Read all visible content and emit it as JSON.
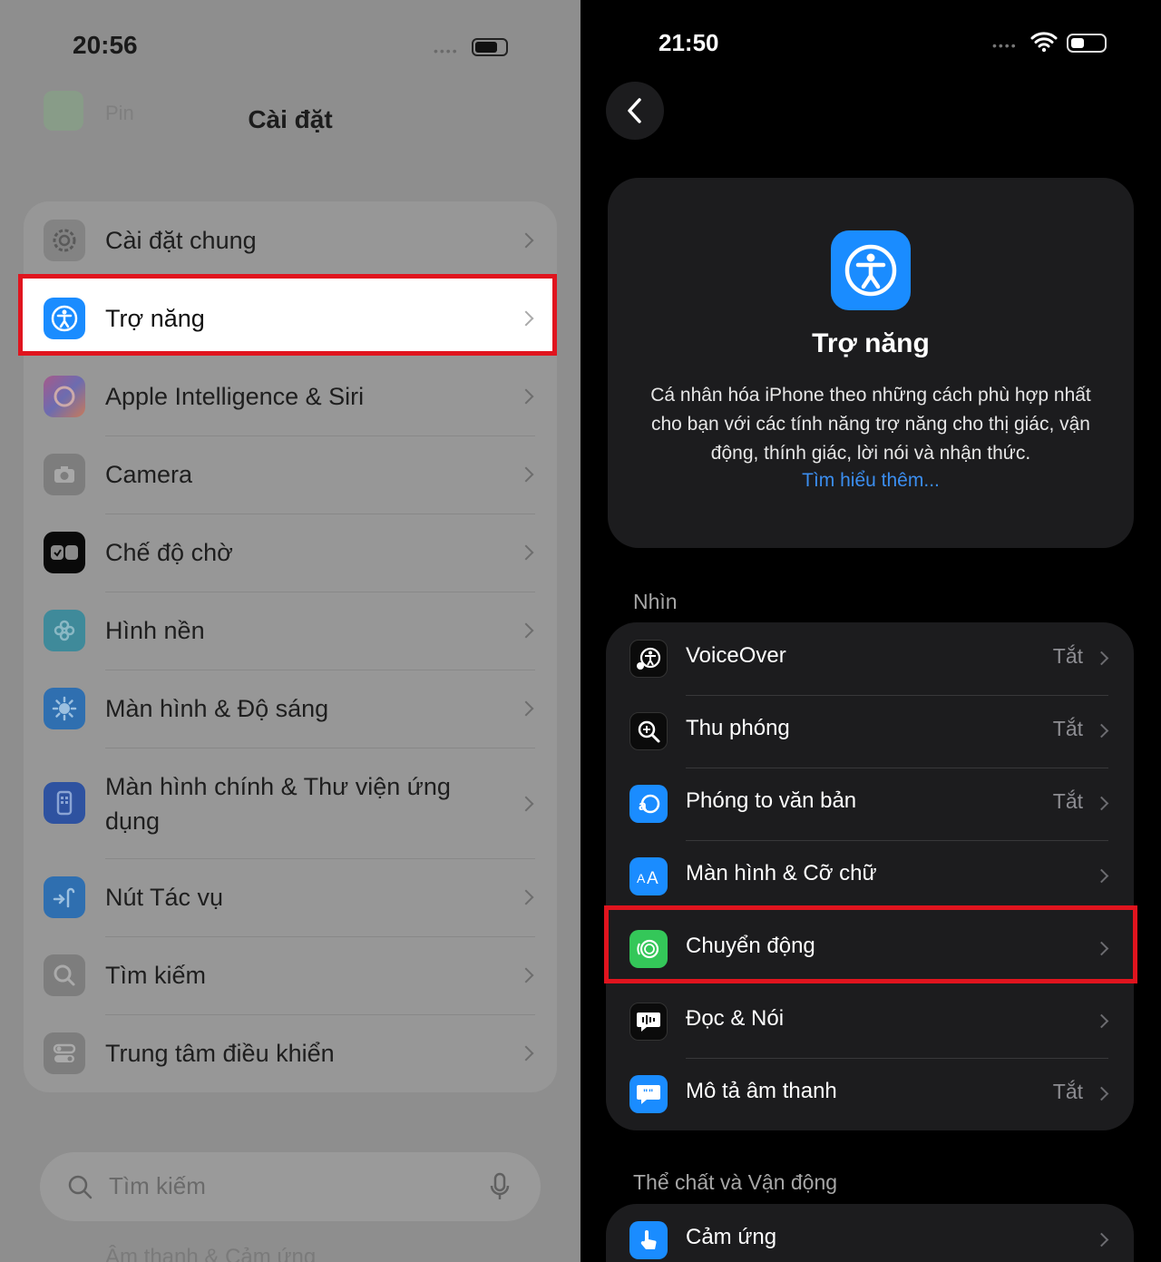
{
  "left": {
    "status_time": "20:56",
    "ghost_text": "Pin",
    "title": "Cài đặt",
    "items": [
      {
        "label": "Cài đặt chung",
        "icon": "gear-icon",
        "color": "#8e8e93"
      },
      {
        "label": "Trợ năng",
        "icon": "accessibility-icon",
        "color": "#1a8cff",
        "highlighted": true
      },
      {
        "label": "Apple Intelligence & Siri",
        "icon": "siri-icon",
        "color": "#b060c0"
      },
      {
        "label": "Camera",
        "icon": "camera-icon",
        "color": "#8e8e93"
      },
      {
        "label": "Chế độ chờ",
        "icon": "standby-icon",
        "color": "#000000"
      },
      {
        "label": "Hình nền",
        "icon": "wallpaper-icon",
        "color": "#34aadc"
      },
      {
        "label": "Màn hình & Độ sáng",
        "icon": "sun-icon",
        "color": "#1a8cff"
      },
      {
        "label": "Màn hình chính & Thư viện ứng dụng",
        "icon": "home-screen-icon",
        "color": "#2b62d8"
      },
      {
        "label": "Nút Tác vụ",
        "icon": "action-button-icon",
        "color": "#1a8cff"
      },
      {
        "label": "Tìm kiếm",
        "icon": "search-icon",
        "color": "#8e8e93"
      },
      {
        "label": "Trung tâm điều khiển",
        "icon": "control-center-icon",
        "color": "#8e8e93"
      }
    ],
    "search_placeholder": "Tìm kiếm",
    "ghost_bottom": "Âm thanh & Cảm ứng"
  },
  "right": {
    "status_time": "21:50",
    "hero": {
      "title": "Trợ năng",
      "description": "Cá nhân hóa iPhone theo những cách phù hợp nhất cho bạn với các tính năng trợ năng cho thị giác, vận động, thính giác, lời nói và nhận thức.",
      "link": "Tìm hiểu thêm..."
    },
    "section_vision": "Nhìn",
    "vision_items": [
      {
        "label": "VoiceOver",
        "value": "Tắt",
        "icon": "voiceover-icon",
        "color": "#000000"
      },
      {
        "label": "Thu phóng",
        "value": "Tắt",
        "icon": "zoom-icon",
        "color": "#000000"
      },
      {
        "label": "Phóng to văn bản",
        "value": "Tắt",
        "icon": "hover-text-icon",
        "color": "#1a8cff"
      },
      {
        "label": "Màn hình & Cỡ chữ",
        "value": "",
        "icon": "text-size-icon",
        "color": "#1a8cff"
      },
      {
        "label": "Chuyển động",
        "value": "",
        "icon": "motion-icon",
        "color": "#34c759",
        "highlighted": true
      },
      {
        "label": "Đọc & Nói",
        "value": "",
        "icon": "spoken-content-icon",
        "color": "#000000"
      },
      {
        "label": "Mô tả âm thanh",
        "value": "Tắt",
        "icon": "audio-description-icon",
        "color": "#1a8cff"
      }
    ],
    "section_physical": "Thể chất và Vận động",
    "physical_items": [
      {
        "label": "Cảm ứng",
        "value": "",
        "icon": "touch-icon",
        "color": "#1a8cff"
      }
    ]
  }
}
